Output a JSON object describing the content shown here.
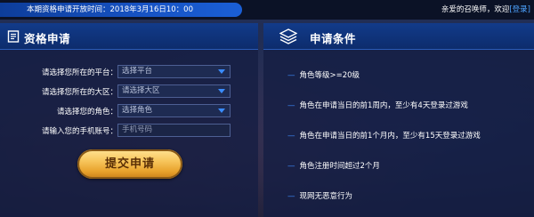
{
  "topbar": {
    "notice": "本期资格申请开放时间：2018年3月16日10：00",
    "greeting": "亲爱的召唤师，欢迎",
    "login_bracket_open": "[",
    "login_label": "登录",
    "login_bracket_close": "]"
  },
  "apply_panel": {
    "title": "资格申请",
    "icon": "document-icon",
    "fields": [
      {
        "label": "请选择您所在的平台：",
        "value": "选择平台",
        "type": "select"
      },
      {
        "label": "请选择您所在的大区：",
        "value": "请选择大区",
        "type": "select"
      },
      {
        "label": "请选择您的角色：",
        "value": "选择角色",
        "type": "select"
      },
      {
        "label": "请输入您的手机账号：",
        "placeholder": "手机号码",
        "type": "text"
      }
    ],
    "submit_label": "提交申请"
  },
  "conditions_panel": {
    "title": "申请条件",
    "icon": "layers-icon",
    "dash": "—",
    "items": [
      "角色等级>=20级",
      "角色在申请当日的前1周内，至少有4天登录过游戏",
      "角色在申请当日的前1个月内，至少有15天登录过游戏",
      "角色注册时间超过2个月",
      "现网无恶意行为"
    ]
  },
  "colors": {
    "accent": "#3c8cff",
    "button_gold": "#f7c55b",
    "header_blue": "#123b8a"
  }
}
